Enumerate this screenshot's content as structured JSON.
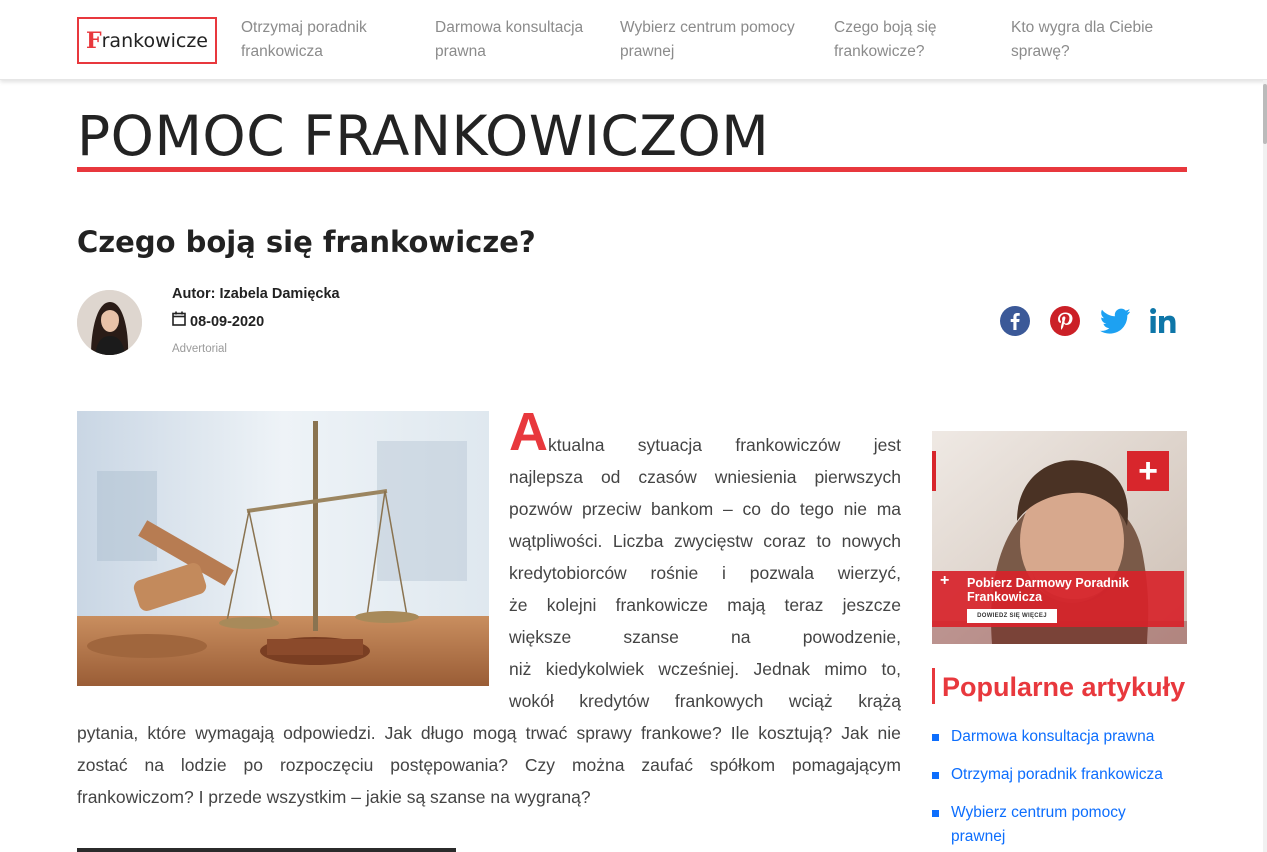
{
  "nav": {
    "logo_initial": "F",
    "logo_rest": "rankowicze",
    "links": [
      "Otrzymaj poradnik frankowicza",
      "Darmowa konsultacja prawna",
      "Wybierz centrum pomocy prawnej",
      "Czego boją się frankowicze?",
      "Kto wygra dla Ciebie sprawę?"
    ]
  },
  "page": {
    "heading": "POMOC FRANKOWICZOM",
    "article_title": "Czego boją się frankowicze?"
  },
  "author": {
    "name_line": "Autor: Izabela Damięcka",
    "date": "08-09-2020",
    "label": "Advertorial"
  },
  "share": {
    "icons": [
      "facebook-icon",
      "pinterest-icon",
      "twitter-icon",
      "linkedin-icon"
    ],
    "colors": {
      "facebook": "#3b5998",
      "pinterest": "#cb2027",
      "twitter": "#1da1f2",
      "linkedin": "#0e76a8"
    }
  },
  "article": {
    "drop_cap": "A",
    "lines": [
      "ktualna sytuacja frankowiczów jest",
      "najlepsza od czasów wniesienia pierwszych",
      "pozwów przeciw bankom – co do tego nie ma",
      "wątpliwości. Liczba zwycięstw coraz to nowych",
      "kredytobiorców rośnie i pozwala wierzyć,",
      "że kolejni frankowicze mają teraz jeszcze",
      "większe szanse na powodzenie,",
      "niż kiedykolwiek wcześniej. Jednak mimo to,",
      "wokół kredytów frankowych wciąż krążą",
      "pytania, które wymagają odpowiedzi. Jak długo mogą trwać sprawy frankowe? Ile kosztują? Jak nie",
      "zostać na lodzie po rozpoczęciu postępowania? Czy można zaufać spółkom pomagającym",
      "frankowiczom? I przede wszystkim – jakie są szanse na wygraną?"
    ]
  },
  "sidebar": {
    "ad_title": "Pobierz Darmowy Poradnik Frankowicza",
    "ad_button": "DOWIEDZ SIĘ WIĘCEJ",
    "ad_plus": "+",
    "popular_title": "Popularne artykuły",
    "popular_items": [
      "Darmowa konsultacja prawna",
      "Otrzymaj poradnik frankowicza",
      "Wybierz centrum pomocy prawnej"
    ]
  },
  "colors": {
    "accent": "#e8383d",
    "link": "#0d6efd"
  }
}
